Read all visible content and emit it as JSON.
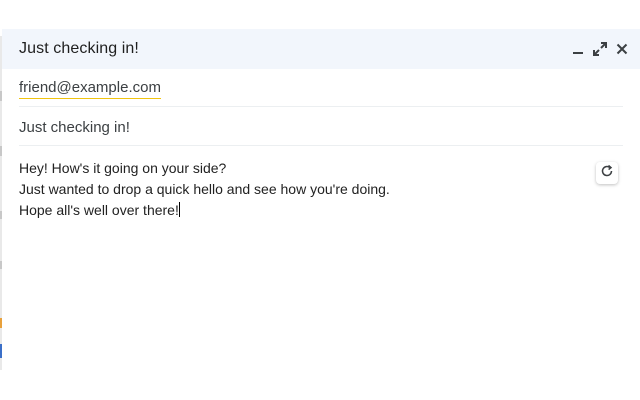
{
  "compose": {
    "title": "Just checking in!",
    "to": {
      "recipient": "friend@example.com"
    },
    "subject": "Just checking in!",
    "body": {
      "lines": [
        "Hey! How's it going on your side?",
        "Just wanted to drop a quick hello and see how you're doing.",
        "Hope all's well over there!"
      ]
    },
    "header_icons": [
      "minimize-icon",
      "expand-icon",
      "close-icon"
    ],
    "side_tool_icon": "refresh-icon"
  },
  "colors": {
    "header_bg": "#f2f6fc",
    "recipient_underline": "#f1c40f",
    "text": "#1f1f1f"
  }
}
